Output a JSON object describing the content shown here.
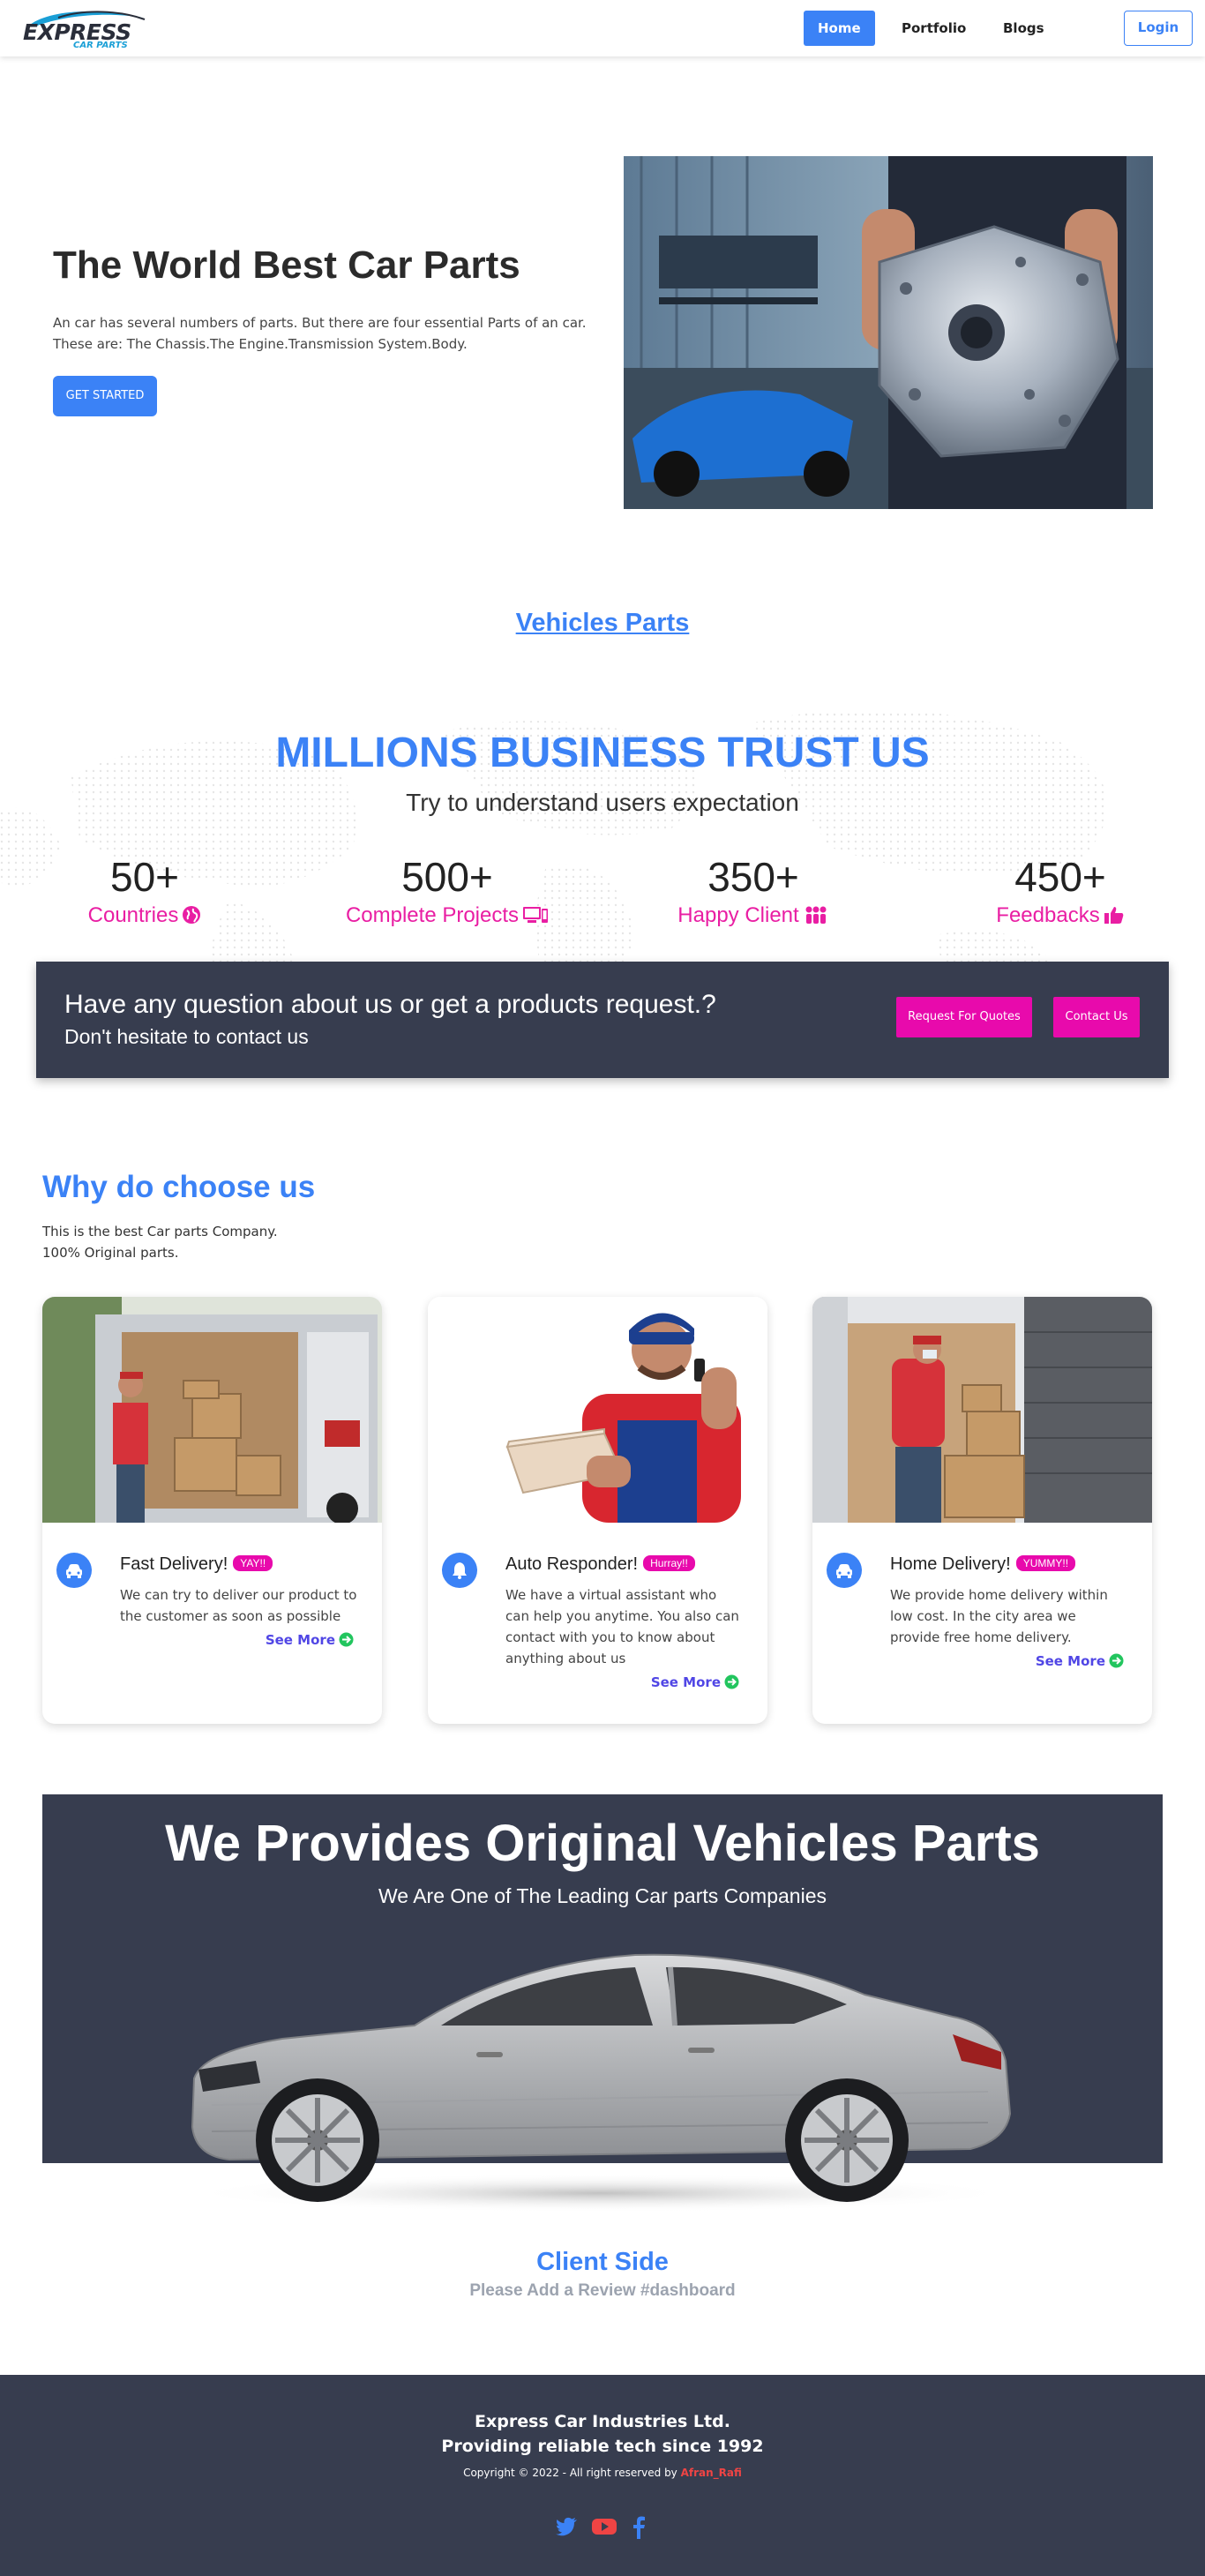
{
  "nav": {
    "logo_main": "EXPRESS",
    "logo_sub": "CAR PARTS",
    "links": [
      "Home",
      "Portfolio",
      "Blogs"
    ],
    "login": "Login"
  },
  "hero": {
    "title": "The World Best Car Parts",
    "description": "An car has several numbers of parts. But there are four essential Parts of an car. These are: The Chassis.The Engine.Transmission System.Body.",
    "cta": "GET STARTED"
  },
  "vehicles_parts_link": "Vehicles Parts",
  "trust": {
    "title": "MILLIONS BUSINESS TRUST US",
    "subtitle": "Try to understand users expectation",
    "stats": [
      {
        "value": "50+",
        "label": "Countries",
        "icon": "globe-icon"
      },
      {
        "value": "500+",
        "label": "Complete Projects",
        "icon": "devices-icon"
      },
      {
        "value": "350+",
        "label": "Happy Client",
        "icon": "users-icon"
      },
      {
        "value": "450+",
        "label": "Feedbacks",
        "icon": "thumbs-up-icon"
      }
    ]
  },
  "contact_banner": {
    "question": "Have any question about us or get a products request.?",
    "note": "Don't hesitate to contact us",
    "quote_button": "Request For Quotes",
    "contact_button": "Contact Us"
  },
  "why": {
    "title": "Why do choose us",
    "line1": "This is the best Car parts Company.",
    "line2": "100% Original parts.",
    "cards": [
      {
        "title": "Fast Delivery!",
        "badge": "YAY!!",
        "text": "We can try to deliver our product to the customer as soon as possible",
        "more": "See More",
        "icon": "car-icon"
      },
      {
        "title": "Auto Responder!",
        "badge": "Hurray!!",
        "text": "We have a virtual assistant who can help you anytime. You also can contact with you to know about anything about us",
        "more": "See More",
        "icon": "bell-icon"
      },
      {
        "title": "Home Delivery!",
        "badge": "YUMMY!!",
        "text": "We provide home delivery within low cost. In the city area we provide free home delivery.",
        "more": "See More",
        "icon": "car-icon"
      }
    ]
  },
  "original": {
    "title": "We Provides Original Vehicles Parts",
    "subtitle": "We Are One of The Leading Car parts Companies"
  },
  "client": {
    "title": "Client Side",
    "subtitle": "Please Add a Review #dashboard"
  },
  "footer": {
    "company": "Express Car Industries Ltd.",
    "tagline": "Providing reliable tech since 1992",
    "copyright": "Copyright © 2022 - All right reserved by",
    "author": "Afran_Rafi"
  },
  "colors": {
    "primary": "#3b82f6",
    "accent": "#e80aac",
    "dark": "#373d4f"
  }
}
